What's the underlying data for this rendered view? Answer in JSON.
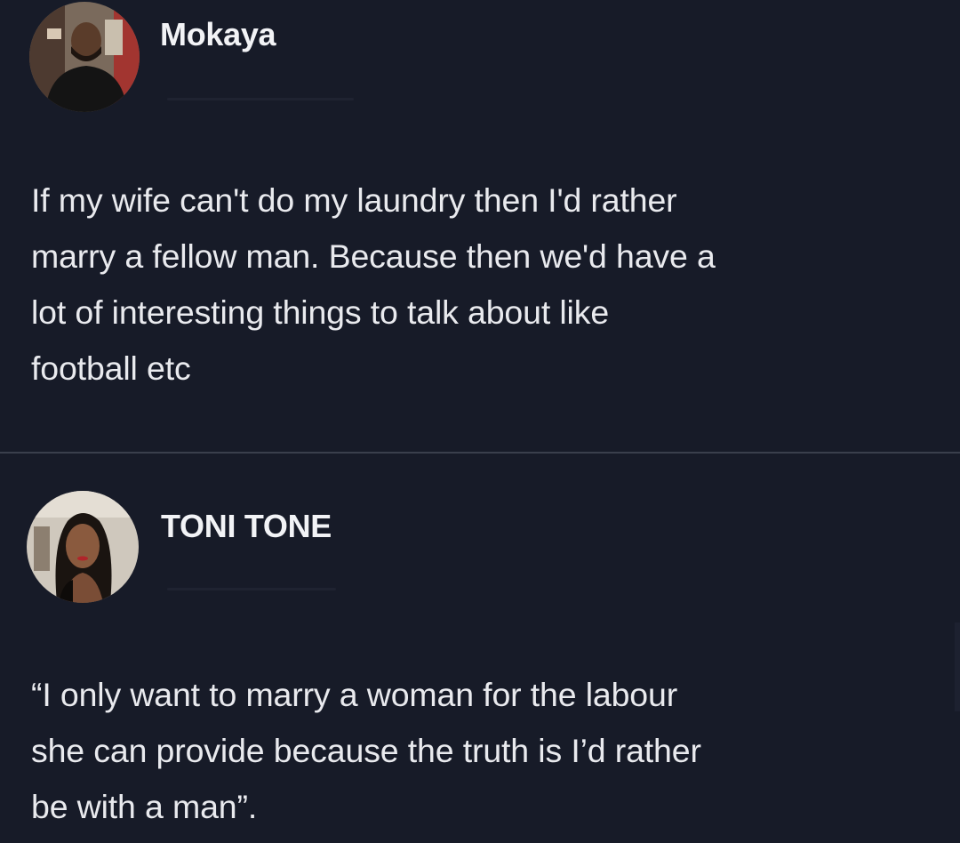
{
  "tweets": [
    {
      "author": {
        "display_name": "Mokaya",
        "avatar": "user-avatar-icon"
      },
      "text_lines": [
        "If my wife can't do my laundry then I'd rather",
        "marry a fellow man. Because then we'd have a",
        "lot of interesting things to talk about like",
        "football etc"
      ]
    },
    {
      "author": {
        "display_name": "TONI TONE",
        "avatar": "user-avatar-icon"
      },
      "text_lines": [
        "“I only want to marry a woman for the labour",
        "she can provide because the truth is I’d rather",
        "be with a man”."
      ]
    }
  ],
  "colors": {
    "background": "#171b28",
    "text": "#e9eaee",
    "divider": "#3a3f4c"
  }
}
